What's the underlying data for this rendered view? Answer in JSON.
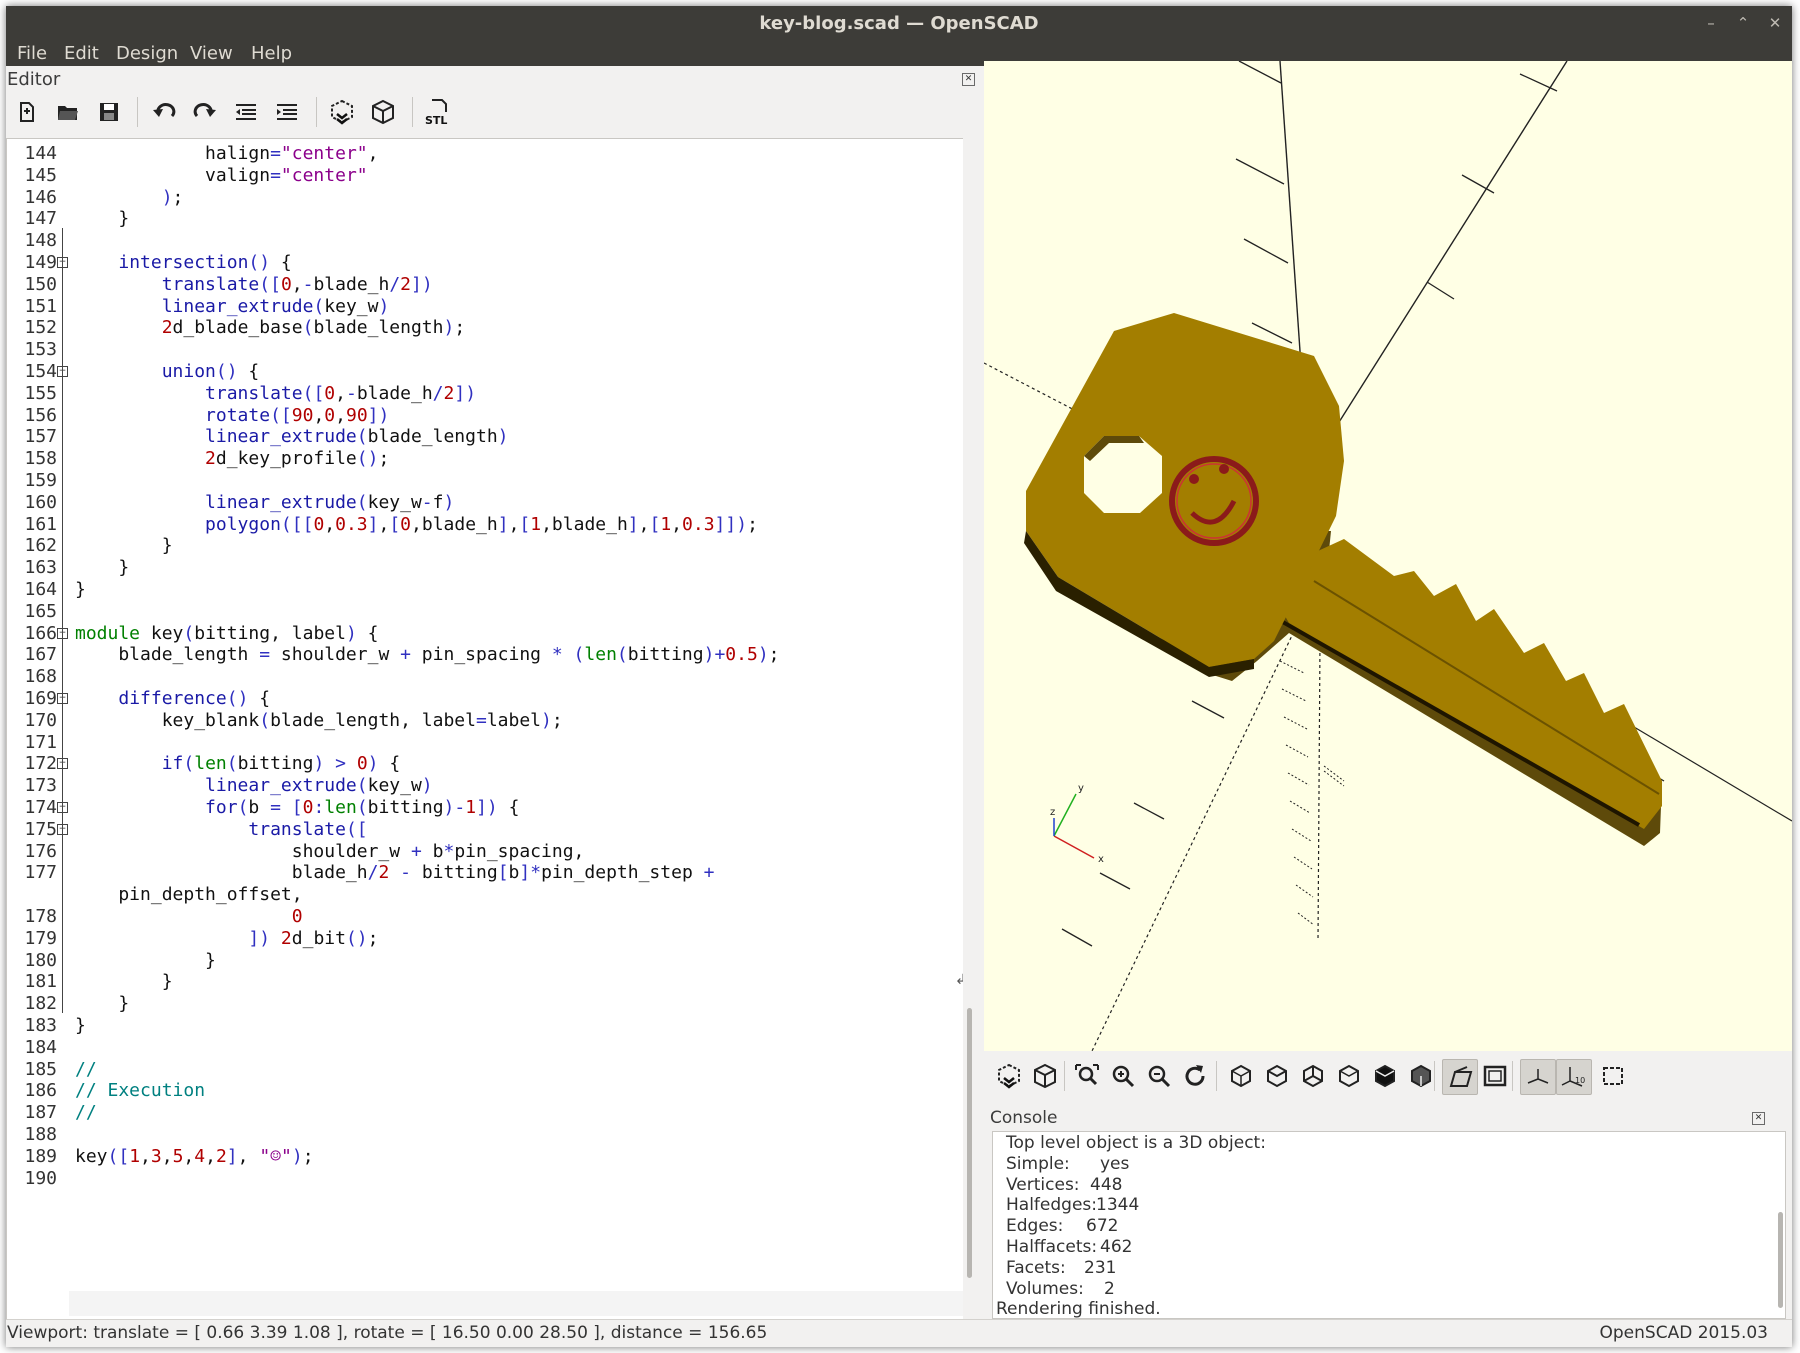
{
  "window": {
    "title": "key-blog.scad — OpenSCAD",
    "controls": [
      "minimize-icon",
      "restore-icon",
      "close-icon"
    ]
  },
  "menu": [
    "File",
    "Edit",
    "Design",
    "View",
    "Help"
  ],
  "editor": {
    "label": "Editor",
    "toolbar": [
      {
        "name": "new-file-icon"
      },
      {
        "name": "open-file-icon"
      },
      {
        "name": "save-icon"
      },
      {
        "name": "undo-icon"
      },
      {
        "name": "redo-icon"
      },
      {
        "name": "unindent-icon"
      },
      {
        "name": "indent-icon"
      },
      {
        "name": "preview-icon"
      },
      {
        "name": "render-icon"
      },
      {
        "name": "export-stl-icon",
        "label": "STL"
      }
    ],
    "lines": [
      {
        "n": "144",
        "code": "            halign=\"center\","
      },
      {
        "n": "145",
        "code": "            valign=\"center\""
      },
      {
        "n": "146",
        "code": "        );"
      },
      {
        "n": "147",
        "code": "    }"
      },
      {
        "n": "148",
        "code": ""
      },
      {
        "n": "149",
        "code": "    intersection() {"
      },
      {
        "n": "150",
        "code": "        translate([0,-blade_h/2])"
      },
      {
        "n": "151",
        "code": "        linear_extrude(key_w)"
      },
      {
        "n": "152",
        "code": "        2d_blade_base(blade_length);"
      },
      {
        "n": "153",
        "code": ""
      },
      {
        "n": "154",
        "code": "        union() {"
      },
      {
        "n": "155",
        "code": "            translate([0,-blade_h/2])"
      },
      {
        "n": "156",
        "code": "            rotate([90,0,90])"
      },
      {
        "n": "157",
        "code": "            linear_extrude(blade_length)"
      },
      {
        "n": "158",
        "code": "            2d_key_profile();"
      },
      {
        "n": "159",
        "code": ""
      },
      {
        "n": "160",
        "code": "            linear_extrude(key_w-f)"
      },
      {
        "n": "161",
        "code": "            polygon([[0,0.3],[0,blade_h],[1,blade_h],[1,0.3]]);"
      },
      {
        "n": "162",
        "code": "        }"
      },
      {
        "n": "163",
        "code": "    }"
      },
      {
        "n": "164",
        "code": "}"
      },
      {
        "n": "165",
        "code": ""
      },
      {
        "n": "166",
        "code": "module key(bitting, label) {"
      },
      {
        "n": "167",
        "code": "    blade_length = shoulder_w + pin_spacing * (len(bitting)+0.5);"
      },
      {
        "n": "168",
        "code": ""
      },
      {
        "n": "169",
        "code": "    difference() {"
      },
      {
        "n": "170",
        "code": "        key_blank(blade_length, label=label);"
      },
      {
        "n": "171",
        "code": ""
      },
      {
        "n": "172",
        "code": "        if(len(bitting) > 0) {"
      },
      {
        "n": "173",
        "code": "            linear_extrude(key_w)"
      },
      {
        "n": "174",
        "code": "            for(b = [0:len(bitting)-1]) {"
      },
      {
        "n": "175",
        "code": "                translate(["
      },
      {
        "n": "176",
        "code": "                    shoulder_w + b*pin_spacing,"
      },
      {
        "n": "177",
        "code": "                    blade_h/2 - bitting[b]*pin_depth_step +"
      },
      {
        "n": "",
        "code": "    pin_depth_offset,"
      },
      {
        "n": "178",
        "code": "                    0"
      },
      {
        "n": "179",
        "code": "                ]) 2d_bit();"
      },
      {
        "n": "180",
        "code": "            }"
      },
      {
        "n": "181",
        "code": "        }"
      },
      {
        "n": "182",
        "code": "    }"
      },
      {
        "n": "183",
        "code": "}"
      },
      {
        "n": "184",
        "code": ""
      },
      {
        "n": "185",
        "code": "//"
      },
      {
        "n": "186",
        "code": "// Execution"
      },
      {
        "n": "187",
        "code": "//"
      },
      {
        "n": "188",
        "code": ""
      },
      {
        "n": "189",
        "code": "key([1,3,5,4,2], \"☺\");"
      },
      {
        "n": "190",
        "code": ""
      }
    ]
  },
  "viewer": {
    "axes_labels": {
      "x": "x",
      "y": "y",
      "z": "z"
    },
    "toolbar": [
      {
        "name": "preview-icon",
        "active": false
      },
      {
        "name": "render-icon",
        "active": false
      },
      {
        "name": "view-all-icon",
        "active": false
      },
      {
        "name": "zoom-in-icon",
        "active": false
      },
      {
        "name": "zoom-out-icon",
        "active": false
      },
      {
        "name": "reset-view-icon",
        "active": false
      },
      {
        "name": "view-right-icon",
        "active": false
      },
      {
        "name": "view-top-icon",
        "active": false
      },
      {
        "name": "view-bottom-icon",
        "active": false
      },
      {
        "name": "view-left-icon",
        "active": false
      },
      {
        "name": "view-front-icon",
        "active": false
      },
      {
        "name": "view-back-icon",
        "active": false
      },
      {
        "name": "perspective-icon",
        "active": true
      },
      {
        "name": "orthogonal-icon",
        "active": false
      },
      {
        "name": "show-axes-icon",
        "active": true
      },
      {
        "name": "show-scale-markers-icon",
        "active": true
      },
      {
        "name": "show-edges-icon",
        "active": false
      }
    ],
    "colors": {
      "background": "#ffffe5",
      "model": "#a37e00",
      "model_side": "#5e4a0a",
      "emboss": "#8b1a1a"
    }
  },
  "console": {
    "label": "Console",
    "lines": [
      {
        "label": "Top level object is a 3D object:",
        "value": ""
      },
      {
        "label": "Simple:",
        "value": "yes"
      },
      {
        "label": "Vertices:",
        "value": "448"
      },
      {
        "label": "Halfedges:",
        "value": "1344"
      },
      {
        "label": "Edges:",
        "value": "672"
      },
      {
        "label": "Halffacets:",
        "value": "462"
      },
      {
        "label": "Facets:",
        "value": "231"
      },
      {
        "label": "Volumes:",
        "value": "2"
      },
      {
        "label": "Rendering finished.",
        "value": ""
      }
    ]
  },
  "status": {
    "viewport": "Viewport: translate = [ 0.66 3.39 1.08 ], rotate = [ 16.50 0.00 28.50 ], distance = 156.65",
    "version": "OpenSCAD 2015.03"
  }
}
